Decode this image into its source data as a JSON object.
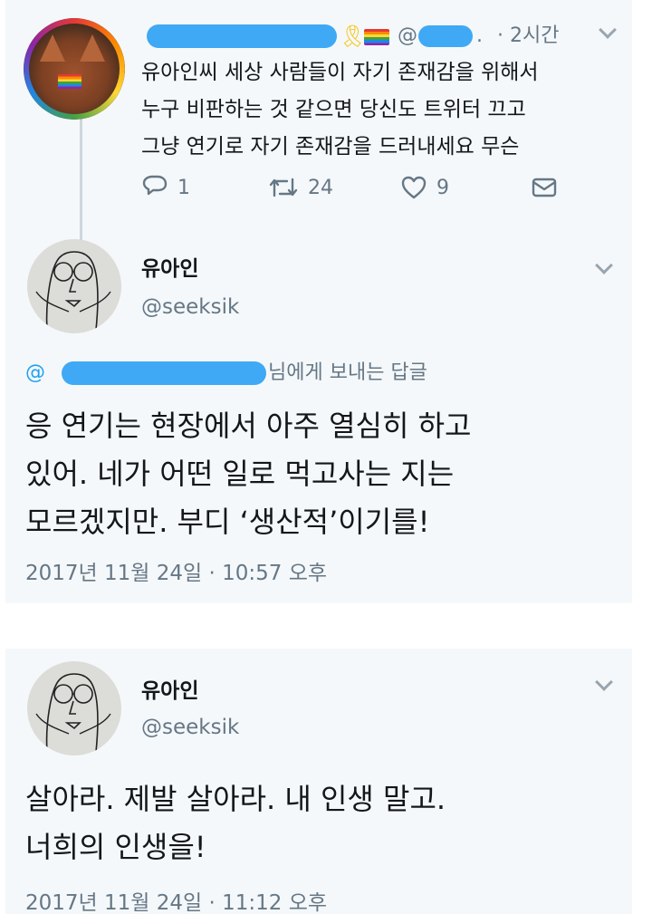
{
  "reply_tweet": {
    "display_name": "",
    "handle_prefix": "@",
    "handle_suffix": ".",
    "time_ago": "· 2시간",
    "text": "유아인씨 세상 사람들이 자기 존재감을 위해서\n누구 비판하는 것 같으면 당신도 트위터 끄고\n그냥 연기로 자기 존재감을 드러내세요 무슨",
    "reply_count": "1",
    "retweet_count": "24",
    "like_count": "9",
    "icons": [
      "ribbon-icon",
      "rainbow-flag-icon",
      "reply-icon",
      "retweet-icon",
      "like-icon",
      "message-icon",
      "chevron-down-icon"
    ]
  },
  "main_tweet": {
    "display_name": "유아인",
    "handle": "@seeksik",
    "replying_prefix": "@",
    "replying_suffix": "님에게 보내는 답글",
    "text": "응 연기는 현장에서 아주 열심히 하고\n있어. 네가 어떤 일로 먹고사는 지는\n모르겠지만. 부디 ‘생산적’이기를!",
    "timestamp": "2017년 11월 24일 · 10:57 오후"
  },
  "second_tweet": {
    "display_name": "유아인",
    "handle": "@seeksik",
    "text": "살아라. 제발 살아라. 내 인생 말고.\n너희의 인생을!",
    "timestamp": "2017년 11월 24일 · 11:12 오후"
  },
  "colors": {
    "card_bg": "#f5f8fa",
    "redaction": "#3fa9f5",
    "muted": "#657786",
    "link": "#1da1f2"
  }
}
